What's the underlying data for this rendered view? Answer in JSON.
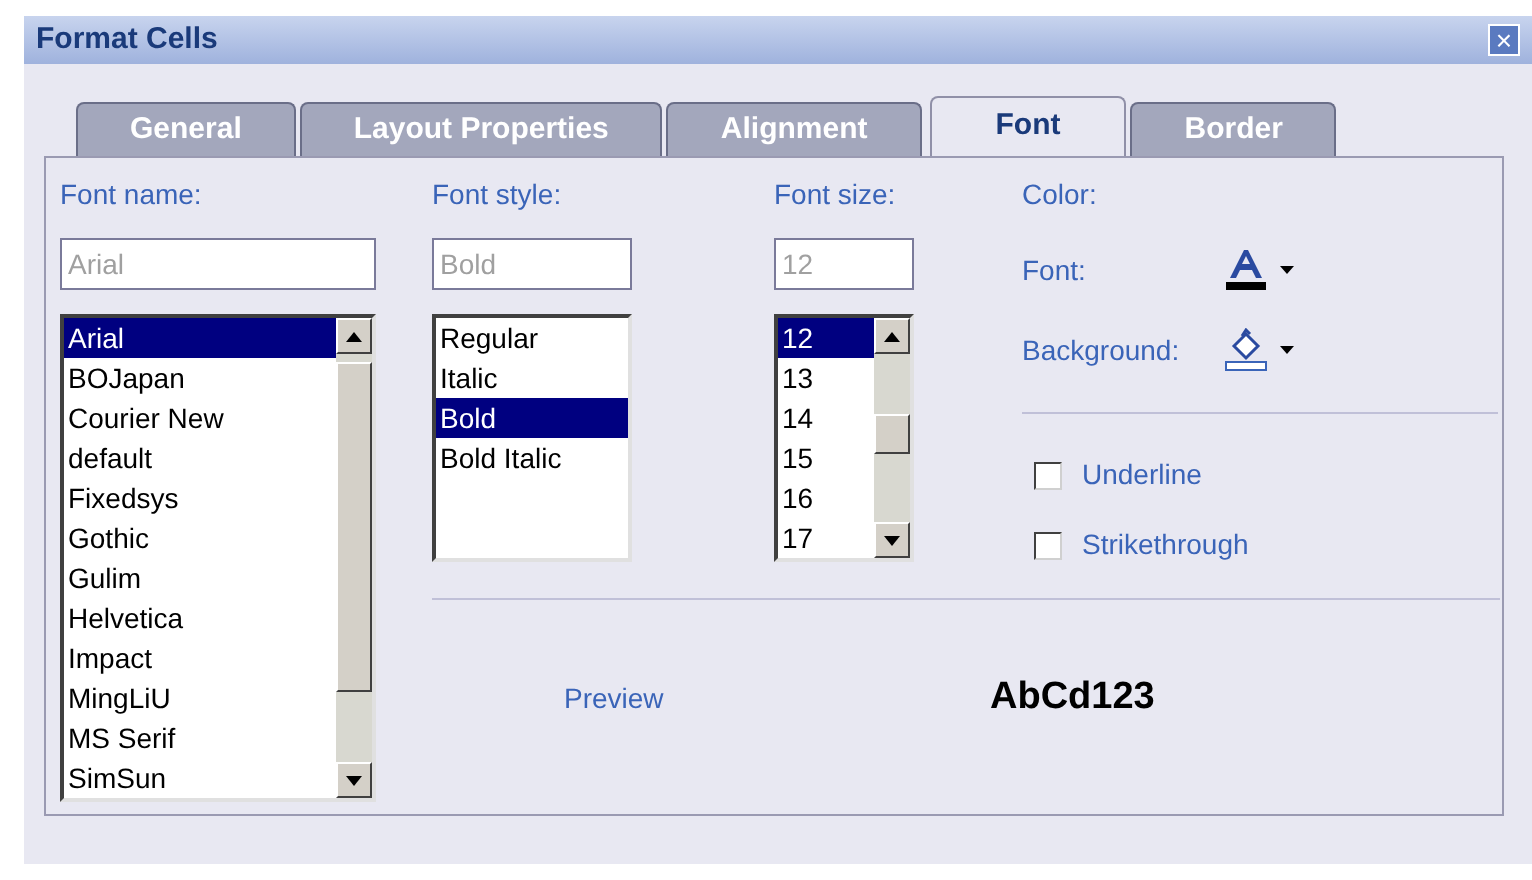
{
  "window": {
    "title": "Format Cells",
    "close": "×"
  },
  "tabs": [
    {
      "label": "General",
      "selected": false
    },
    {
      "label": "Layout Properties",
      "selected": false
    },
    {
      "label": "Alignment",
      "selected": false
    },
    {
      "label": "Font",
      "selected": true
    },
    {
      "label": "Border",
      "selected": false
    }
  ],
  "font_name": {
    "label": "Font name:",
    "value": "Arial",
    "items": [
      {
        "label": "Arial",
        "selected": true
      },
      {
        "label": "BOJapan",
        "selected": false
      },
      {
        "label": "Courier New",
        "selected": false
      },
      {
        "label": "default",
        "selected": false
      },
      {
        "label": "Fixedsys",
        "selected": false
      },
      {
        "label": "Gothic",
        "selected": false
      },
      {
        "label": "Gulim",
        "selected": false
      },
      {
        "label": "Helvetica",
        "selected": false
      },
      {
        "label": "Impact",
        "selected": false
      },
      {
        "label": "MingLiU",
        "selected": false
      },
      {
        "label": "MS Serif",
        "selected": false
      },
      {
        "label": "SimSun",
        "selected": false
      }
    ]
  },
  "font_style": {
    "label": "Font style:",
    "value": "Bold",
    "items": [
      {
        "label": "Regular",
        "selected": false
      },
      {
        "label": "Italic",
        "selected": false
      },
      {
        "label": "Bold",
        "selected": true
      },
      {
        "label": "Bold Italic",
        "selected": false
      }
    ]
  },
  "font_size": {
    "label": "Font size:",
    "value": "12",
    "items": [
      {
        "label": "12",
        "selected": true
      },
      {
        "label": "13",
        "selected": false
      },
      {
        "label": "14",
        "selected": false
      },
      {
        "label": "15",
        "selected": false
      },
      {
        "label": "16",
        "selected": false
      },
      {
        "label": "17",
        "selected": false
      }
    ]
  },
  "color": {
    "label": "Color:",
    "font_label": "Font:",
    "background_label": "Background:"
  },
  "options": [
    {
      "label": "Underline",
      "checked": false
    },
    {
      "label": "Strikethrough",
      "checked": false
    }
  ],
  "preview": {
    "label": "Preview",
    "sample": "AbCd123"
  }
}
